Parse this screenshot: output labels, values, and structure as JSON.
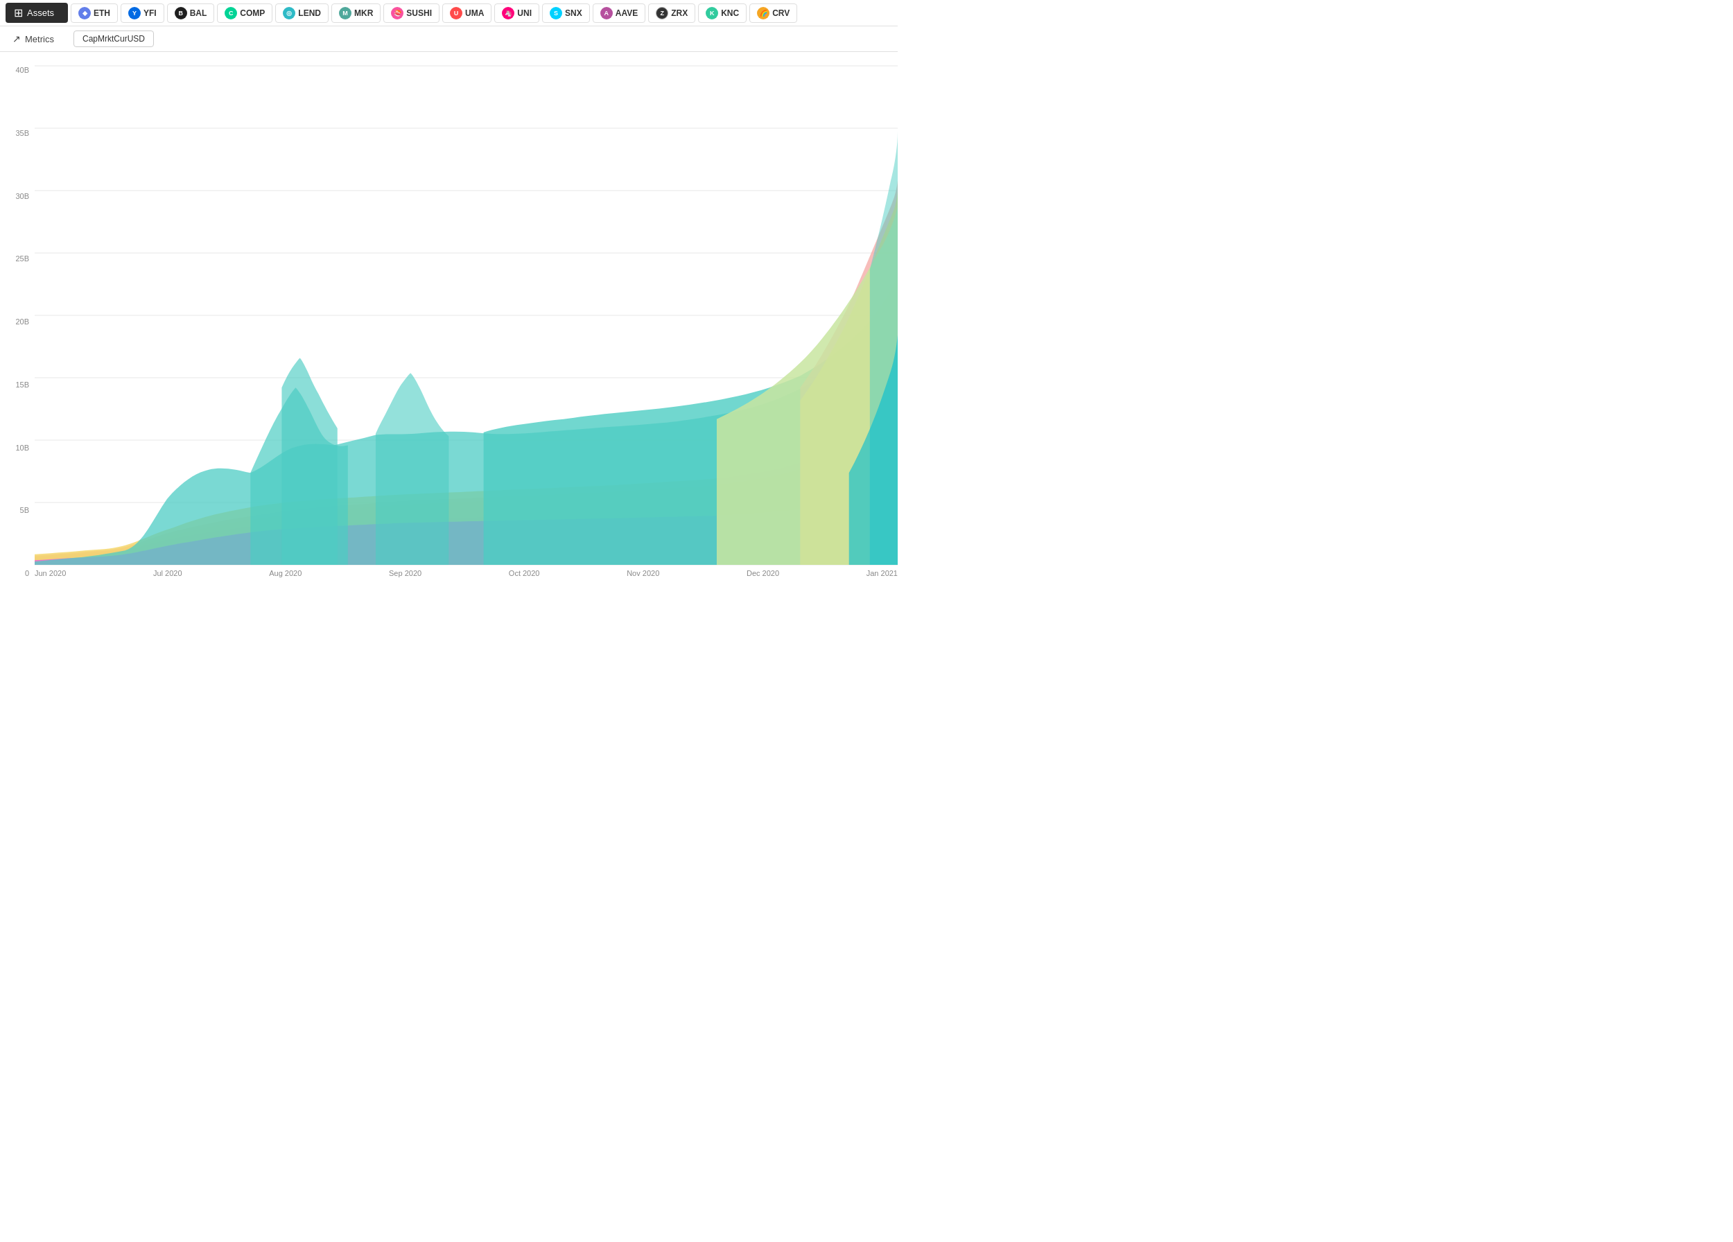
{
  "header": {
    "assets_label": "Assets",
    "metrics_label": "Metrics",
    "metric_active": "CapMrktCurUSD"
  },
  "assets": [
    {
      "symbol": "ETH",
      "color": "#627EEA",
      "bg": "#627EEA"
    },
    {
      "symbol": "YFI",
      "color": "#006AE3",
      "bg": "#006AE3"
    },
    {
      "symbol": "BAL",
      "color": "#1E1E1E",
      "bg": "#1E1E1E"
    },
    {
      "symbol": "COMP",
      "color": "#00D395",
      "bg": "#00D395"
    },
    {
      "symbol": "LEND",
      "color": "#2EBAC6",
      "bg": "#2EBAC6"
    },
    {
      "symbol": "MKR",
      "color": "#4FA89B",
      "bg": "#4FA89B"
    },
    {
      "symbol": "SUSHI",
      "color": "#FA52A0",
      "bg": "#FA52A0"
    },
    {
      "symbol": "UMA",
      "color": "#FF4A4A",
      "bg": "#FF4A4A"
    },
    {
      "symbol": "UNI",
      "color": "#FF007A",
      "bg": "#FF007A"
    },
    {
      "symbol": "SNX",
      "color": "#00D1FF",
      "bg": "#00D1FF"
    },
    {
      "symbol": "AAVE",
      "color": "#B6509E",
      "bg": "#B6509E"
    },
    {
      "symbol": "ZRX",
      "color": "#231815",
      "bg": "#333"
    },
    {
      "symbol": "KNC",
      "color": "#31CB9E",
      "bg": "#31CB9E"
    },
    {
      "symbol": "CRV",
      "color": "#F5A623",
      "bg": "#F5A623"
    }
  ],
  "y_labels": [
    "0",
    "5B",
    "10B",
    "15B",
    "20B",
    "25B",
    "30B",
    "35B",
    "40B"
  ],
  "x_labels": [
    "Jun 2020",
    "Jul 2020",
    "Aug 2020",
    "Sep 2020",
    "Oct 2020",
    "Nov 2020",
    "Dec 2020",
    "Jan 2021"
  ]
}
